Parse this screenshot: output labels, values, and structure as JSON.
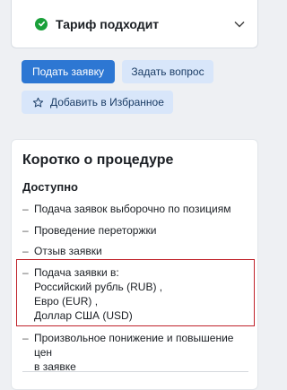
{
  "tariff": {
    "status_text": "Тариф подходит"
  },
  "actions": {
    "submit_label": "Подать заявку",
    "ask_label": "Задать вопрос",
    "favorite_label": "Добавить в Избранное"
  },
  "procedure": {
    "title": "Коротко о процедуре",
    "subtitle": "Доступно",
    "items": [
      {
        "text": "Подача заявок выборочно по позициям"
      },
      {
        "text": "Проведение переторжки"
      },
      {
        "text": "Отзыв заявки"
      },
      {
        "lines": [
          "Подача заявки в:",
          "Российский рубль (RUB) ,",
          "Евро (EUR) ,",
          "Доллар США (USD)"
        ]
      },
      {
        "lines": [
          "Произвольное понижение и повышение цен",
          "в заявке"
        ]
      }
    ]
  },
  "colors": {
    "accent": "#2d77d3",
    "success": "#1aa03a",
    "highlight_border": "#c0232b"
  }
}
